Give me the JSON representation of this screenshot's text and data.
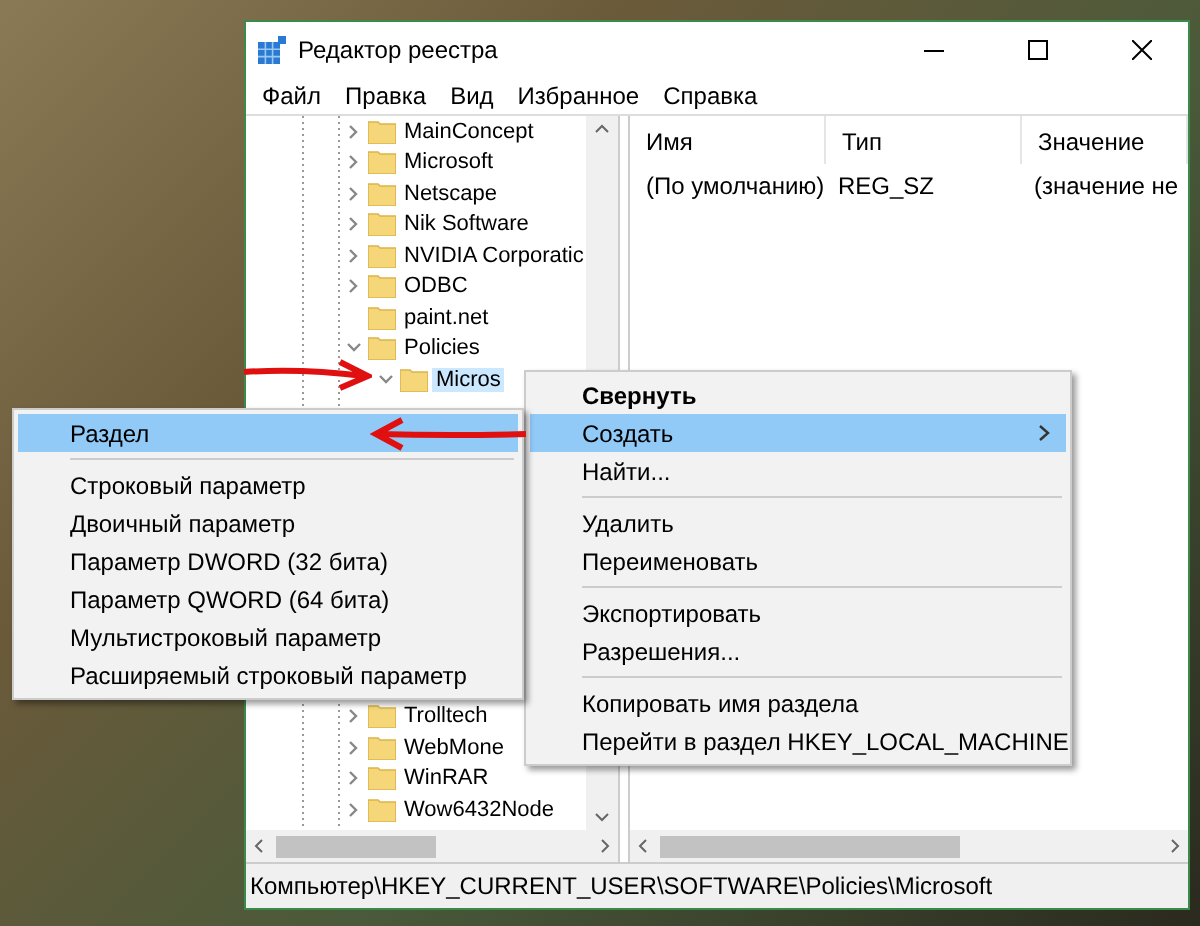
{
  "window": {
    "title": "Редактор реестра"
  },
  "menu_bar": [
    "Файл",
    "Правка",
    "Вид",
    "Избранное",
    "Справка"
  ],
  "tree": {
    "items": [
      {
        "label": "MainConcept",
        "has_children": true,
        "expanded": false,
        "selected": false
      },
      {
        "label": "Microsoft",
        "has_children": true,
        "expanded": false,
        "selected": false
      },
      {
        "label": "Netscape",
        "has_children": true,
        "expanded": false,
        "selected": false
      },
      {
        "label": "Nik Software",
        "has_children": true,
        "expanded": false,
        "selected": false
      },
      {
        "label": "NVIDIA Corporatic",
        "has_children": true,
        "expanded": false,
        "selected": false
      },
      {
        "label": "ODBC",
        "has_children": true,
        "expanded": false,
        "selected": false
      },
      {
        "label": "paint.net",
        "has_children": false,
        "expanded": false,
        "selected": false
      },
      {
        "label": "Policies",
        "has_children": true,
        "expanded": true,
        "selected": false,
        "children": [
          {
            "label": "Micros",
            "has_children": true,
            "expanded": true,
            "selected": true
          }
        ]
      },
      {
        "label": "Trolltech",
        "has_children": true,
        "expanded": false,
        "selected": false
      },
      {
        "label": "WebMone",
        "has_children": true,
        "expanded": false,
        "selected": false
      },
      {
        "label": "WinRAR",
        "has_children": true,
        "expanded": false,
        "selected": false
      },
      {
        "label": "Wow6432Node",
        "has_children": true,
        "expanded": false,
        "selected": false
      }
    ]
  },
  "values": {
    "columns": [
      "Имя",
      "Тип",
      "Значение"
    ],
    "rows": [
      {
        "name": "(По умолчанию)",
        "type": "REG_SZ",
        "value": "(значение не"
      }
    ]
  },
  "context_menu": {
    "items": [
      {
        "kind": "item",
        "label": "Свернуть",
        "default": true,
        "selected": false,
        "submenu": false
      },
      {
        "kind": "item",
        "label": "Создать",
        "default": false,
        "selected": true,
        "submenu": true
      },
      {
        "kind": "item",
        "label": "Найти...",
        "default": false,
        "selected": false,
        "submenu": false
      },
      {
        "kind": "separator"
      },
      {
        "kind": "item",
        "label": "Удалить",
        "default": false,
        "selected": false,
        "submenu": false
      },
      {
        "kind": "item",
        "label": "Переименовать",
        "default": false,
        "selected": false,
        "submenu": false
      },
      {
        "kind": "separator"
      },
      {
        "kind": "item",
        "label": "Экспортировать",
        "default": false,
        "selected": false,
        "submenu": false
      },
      {
        "kind": "item",
        "label": "Разрешения...",
        "default": false,
        "selected": false,
        "submenu": false
      },
      {
        "kind": "separator"
      },
      {
        "kind": "item",
        "label": "Копировать имя раздела",
        "default": false,
        "selected": false,
        "submenu": false
      },
      {
        "kind": "item",
        "label": "Перейти в раздел HKEY_LOCAL_MACHINE",
        "default": false,
        "selected": false,
        "submenu": false
      }
    ]
  },
  "submenu": {
    "items": [
      {
        "kind": "item",
        "label": "Раздел",
        "default": false,
        "selected": true,
        "submenu": false
      },
      {
        "kind": "separator"
      },
      {
        "kind": "item",
        "label": "Строковый параметр",
        "default": false,
        "selected": false,
        "submenu": false
      },
      {
        "kind": "item",
        "label": "Двоичный параметр",
        "default": false,
        "selected": false,
        "submenu": false
      },
      {
        "kind": "item",
        "label": "Параметр DWORD (32 бита)",
        "default": false,
        "selected": false,
        "submenu": false
      },
      {
        "kind": "item",
        "label": "Параметр QWORD (64 бита)",
        "default": false,
        "selected": false,
        "submenu": false
      },
      {
        "kind": "item",
        "label": "Мультистроковый параметр",
        "default": false,
        "selected": false,
        "submenu": false
      },
      {
        "kind": "item",
        "label": "Расширяемый строковый параметр",
        "default": false,
        "selected": false,
        "submenu": false
      }
    ]
  },
  "status_bar": "Компьютер\\HKEY_CURRENT_USER\\SOFTWARE\\Policies\\Microsoft"
}
